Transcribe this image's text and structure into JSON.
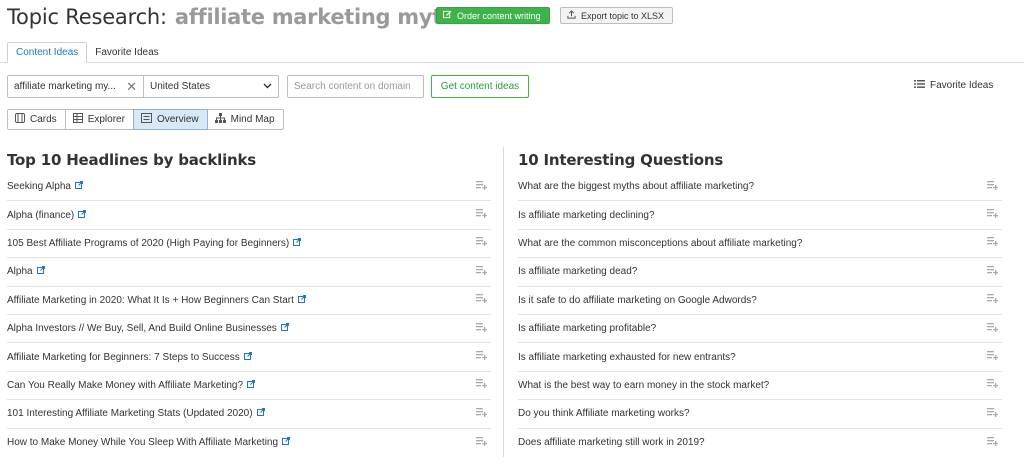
{
  "header": {
    "title": "Topic Research:",
    "topic": "affiliate marketing myths",
    "order_button": "Order content writing",
    "export_button": "Export topic to XLSX"
  },
  "tabs": [
    {
      "label": "Content Ideas",
      "active": true
    },
    {
      "label": "Favorite Ideas",
      "active": false
    }
  ],
  "controls": {
    "keyword_value": "affiliate marketing my...",
    "country_value": "United States",
    "search_placeholder": "Search content on domain",
    "get_button": "Get content ideas",
    "favorite_ideas": "Favorite Ideas"
  },
  "views": [
    {
      "label": "Cards",
      "icon": "cards-icon",
      "active": false
    },
    {
      "label": "Explorer",
      "icon": "table-icon",
      "active": false
    },
    {
      "label": "Overview",
      "icon": "overview-icon",
      "active": true
    },
    {
      "label": "Mind Map",
      "icon": "mindmap-icon",
      "active": false
    }
  ],
  "headlines": {
    "title": "Top 10 Headlines by backlinks",
    "items": [
      "Seeking Alpha",
      "Alpha (finance)",
      "105 Best Affiliate Programs of 2020 (High Paying for Beginners)",
      "Alpha",
      "Affiliate Marketing in 2020: What It Is + How Beginners Can Start",
      "Alpha Investors // We Buy, Sell, And Build Online Businesses",
      "Affiliate Marketing for Beginners: 7 Steps to Success",
      "Can You Really Make Money with Affiliate Marketing?",
      "101 Interesting Affiliate Marketing Stats (Updated 2020)",
      "How to Make Money While You Sleep With Affiliate Marketing"
    ]
  },
  "questions": {
    "title": "10 Interesting Questions",
    "items": [
      "What are the biggest myths about affiliate marketing?",
      "Is affiliate marketing declining?",
      "What are the common misconceptions about affiliate marketing?",
      "Is affiliate marketing dead?",
      "Is it safe to do affiliate marketing on Google Adwords?",
      "Is affiliate marketing profitable?",
      "Is affiliate marketing exhausted for new entrants?",
      "What is the best way to earn money in the stock market?",
      "Do you think Affiliate marketing works?",
      "Does affiliate marketing still work in 2019?"
    ]
  },
  "colors": {
    "green": "#3db34a",
    "link_icon": "#1d78c1",
    "active_view": "#d9e8f5"
  }
}
